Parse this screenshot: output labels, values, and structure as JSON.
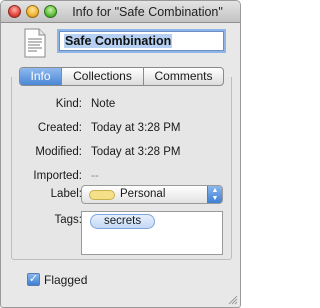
{
  "window": {
    "title": "Info for \"Safe Combination\"",
    "name_value": "Safe Combination"
  },
  "tabs": [
    {
      "label": "Info",
      "active": true
    },
    {
      "label": "Collections",
      "active": false
    },
    {
      "label": "Comments",
      "active": false
    }
  ],
  "info": {
    "kind_label": "Kind:",
    "kind_value": "Note",
    "created_label": "Created:",
    "created_value": "Today at 3:28 PM",
    "modified_label": "Modified:",
    "modified_value": "Today at 3:28 PM",
    "imported_label": "Imported:",
    "imported_value": "--",
    "label_label": "Label:",
    "label_value": "Personal",
    "label_color": "#f5e08a",
    "tags_label": "Tags:",
    "tags": [
      "secrets"
    ]
  },
  "flagged": {
    "label": "Flagged",
    "checked": true
  },
  "icons": {
    "close": "close-button-red",
    "minimize": "minimize-button-yellow",
    "zoom": "zoom-button-green",
    "document": "note-document-icon",
    "popup_arrows": "up-down-arrows-icon",
    "checkmark": "checkmark-icon",
    "resize": "resize-grip-icon"
  }
}
